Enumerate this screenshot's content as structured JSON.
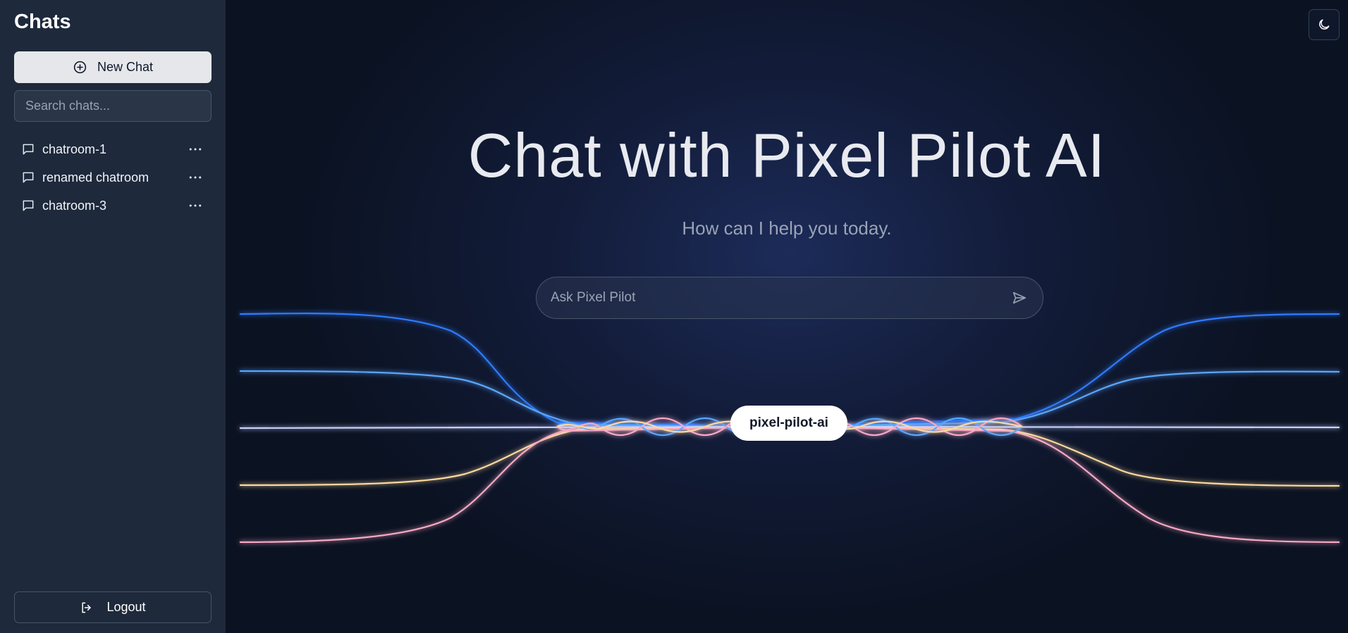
{
  "sidebar": {
    "title": "Chats",
    "new_chat_label": "New Chat",
    "search_placeholder": "Search chats...",
    "items": [
      {
        "label": "chatroom-1"
      },
      {
        "label": "renamed chatroom"
      },
      {
        "label": "chatroom-3"
      }
    ],
    "logout_label": "Logout"
  },
  "main": {
    "headline": "Chat with Pixel Pilot AI",
    "subtitle": "How can I help you today.",
    "ask_placeholder": "Ask Pixel Pilot",
    "model_label": "pixel-pilot-ai"
  },
  "icons": {
    "new_chat": "plus-circle-icon",
    "chat": "message-square-icon",
    "more": "more-horizontal-icon",
    "logout": "log-out-icon",
    "theme": "moon-icon",
    "send": "send-icon"
  },
  "colors": {
    "sidebar_bg": "#1e293b",
    "main_bg": "#0b1222",
    "wave_blue": "#2f7bff",
    "wave_light_blue": "#5aa6ff",
    "wave_lavender": "#c7d2fe",
    "wave_yellow": "#fcd9a0",
    "wave_pink": "#f9a8c4"
  }
}
